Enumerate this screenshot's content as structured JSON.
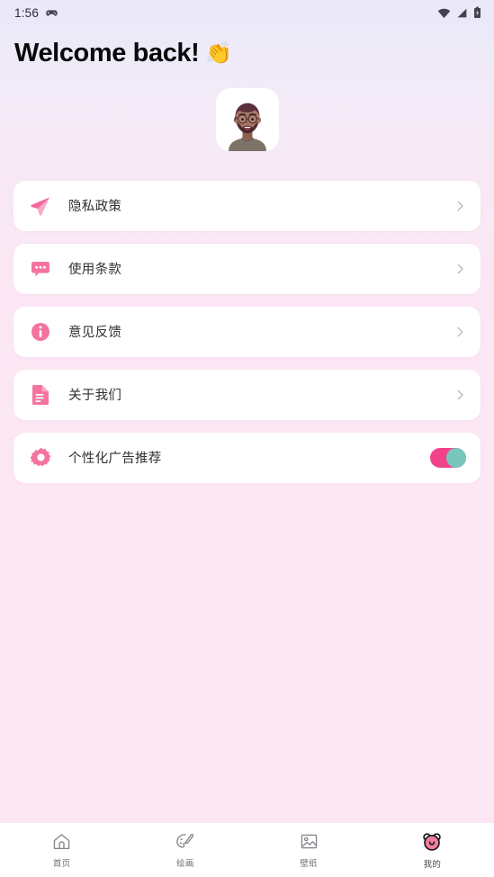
{
  "status_bar": {
    "time": "1:56",
    "icons": [
      "game-controller-icon",
      "wifi-icon",
      "cellular-signal-icon",
      "battery-icon"
    ]
  },
  "header": {
    "title": "Welcome back!",
    "emoji": "👏"
  },
  "profile": {
    "avatar_name": "user-avatar",
    "avatar_bg": "#ffffff"
  },
  "theme": {
    "accent_pink": "#f48fb6",
    "toggle_on_track": "#f2428a",
    "toggle_knob": "#79c6bd",
    "card_bg": "#ffffff",
    "page_bg_top": "#e9e8f9",
    "page_bg_bottom": "#fde7f3",
    "label_color": "#2f3033"
  },
  "menu": {
    "items": [
      {
        "label": "隐私政策",
        "icon": "send-icon",
        "type": "link",
        "chevron": "chevron-right-icon"
      },
      {
        "label": "使用条款",
        "icon": "chat-bubble-icon",
        "type": "link",
        "chevron": "chevron-right-icon"
      },
      {
        "label": "意见反馈",
        "icon": "info-circle-icon",
        "type": "link",
        "chevron": "chevron-right-icon"
      },
      {
        "label": "关于我们",
        "icon": "document-icon",
        "type": "link",
        "chevron": "chevron-right-icon"
      },
      {
        "label": "个性化广告推荐",
        "icon": "gear-icon",
        "type": "toggle",
        "toggle_on": true
      }
    ]
  },
  "bottom_nav": {
    "items": [
      {
        "label": "首页",
        "icon": "home-icon",
        "active": false
      },
      {
        "label": "绘画",
        "icon": "palette-icon",
        "active": false
      },
      {
        "label": "壁纸",
        "icon": "image-icon",
        "active": false
      },
      {
        "label": "我的",
        "icon": "bear-face-icon",
        "active": true
      }
    ]
  }
}
